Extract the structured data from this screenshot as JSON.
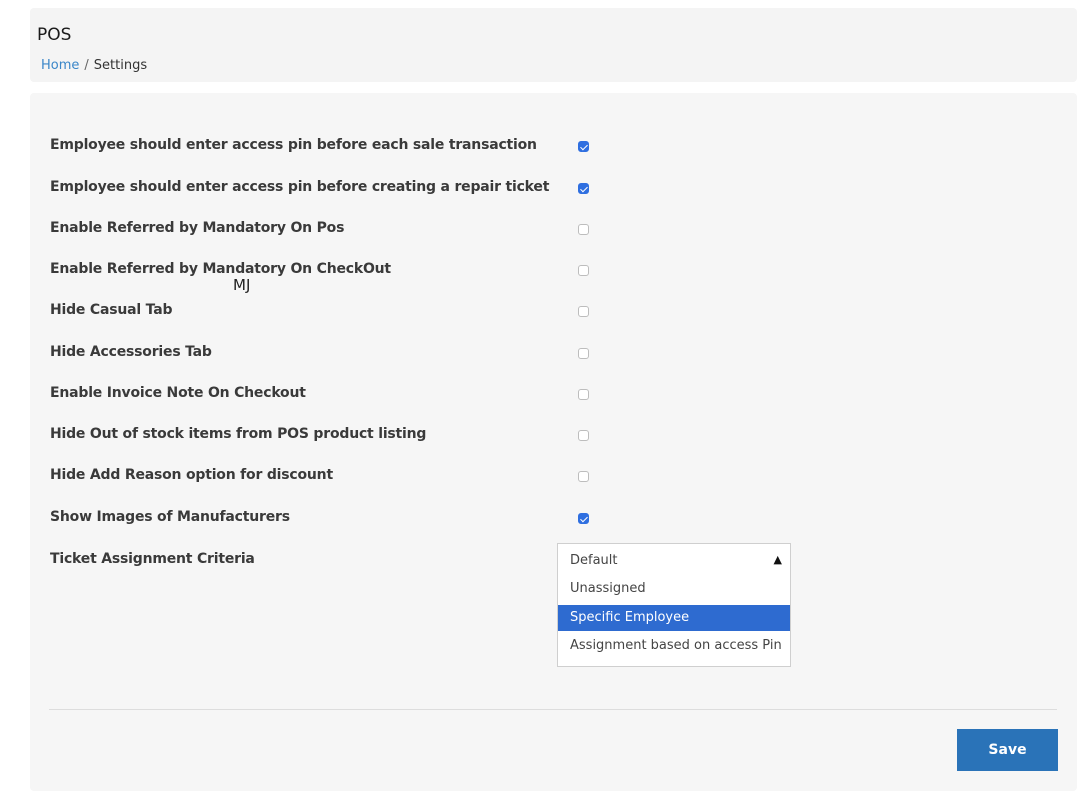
{
  "header": {
    "title": "POS",
    "breadcrumb": {
      "home": "Home",
      "separator": "/",
      "current": "Settings"
    }
  },
  "settings": [
    {
      "label": "Employee should enter access pin before each sale transaction",
      "checked": true
    },
    {
      "label": "Employee should enter access pin before creating a repair ticket",
      "checked": true
    },
    {
      "label": "Enable Referred by Mandatory On Pos",
      "checked": false
    },
    {
      "label": "Enable Referred by Mandatory On CheckOut",
      "checked": false
    },
    {
      "label": "Hide Casual Tab",
      "checked": false
    },
    {
      "label": "Hide Accessories Tab",
      "checked": false
    },
    {
      "label": "Enable Invoice Note On Checkout",
      "checked": false
    },
    {
      "label": "Hide Out of stock items from POS product listing",
      "checked": false
    },
    {
      "label": "Hide Add Reason option for discount",
      "checked": false
    },
    {
      "label": "Show Images of Manufacturers",
      "checked": true
    }
  ],
  "overlay_text": "MJ",
  "ticket_assignment": {
    "label": "Ticket Assignment Criteria",
    "selected": "Default",
    "arrow_icon": "triangle-up",
    "options": [
      {
        "label": "Unassigned",
        "highlighted": false
      },
      {
        "label": "Specific Employee",
        "highlighted": true
      },
      {
        "label": "Assignment based on access Pin",
        "highlighted": false
      }
    ]
  },
  "actions": {
    "save_label": "Save"
  },
  "colors": {
    "accent": "#2f6fe0",
    "link": "#3a86c8",
    "save_button": "#2a73b8",
    "highlight": "#2e6bd0"
  }
}
